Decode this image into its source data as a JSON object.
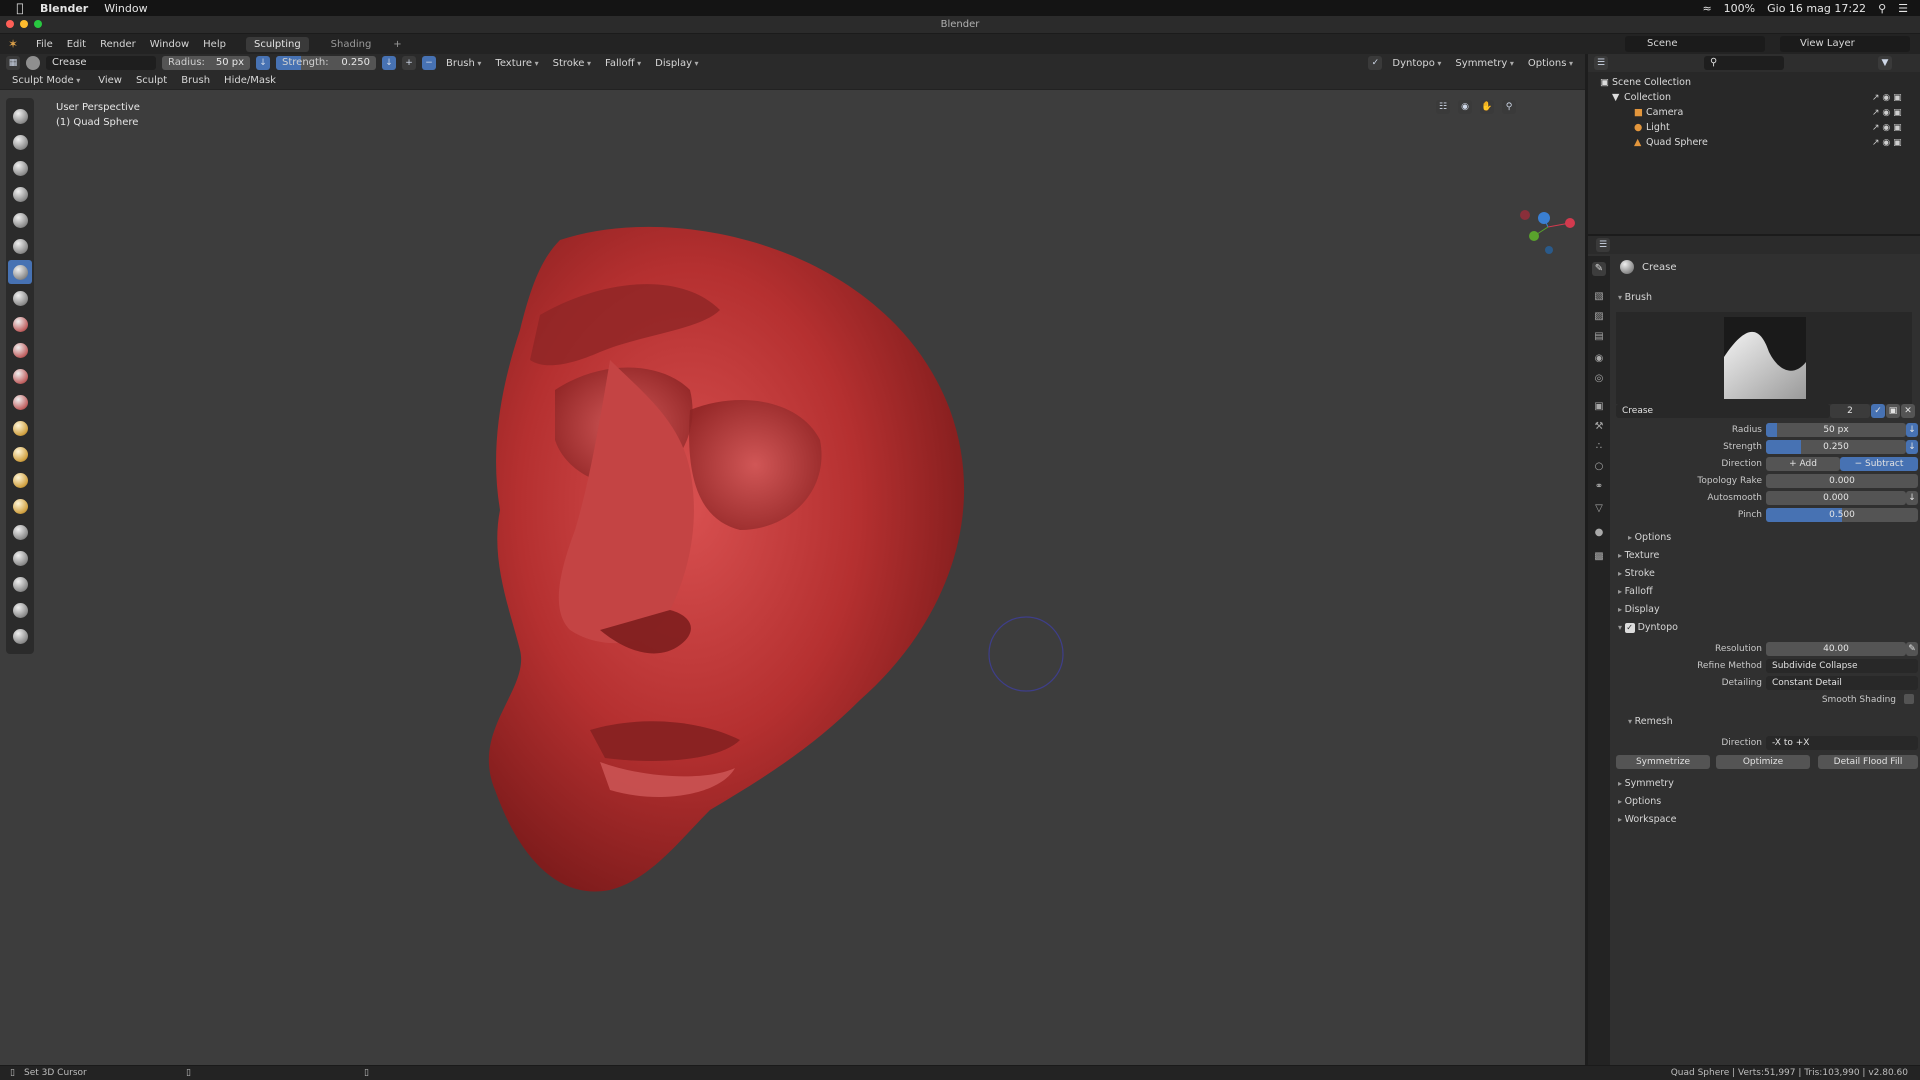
{
  "macbar": {
    "app_name": "Blender",
    "menu_window": "Window",
    "battery": "100%",
    "datetime": "Gio 16 mag  17:22"
  },
  "window": {
    "title": "Blender"
  },
  "menu": {
    "items": [
      "File",
      "Edit",
      "Render",
      "Window",
      "Help"
    ],
    "workspaces": [
      "Sculpting",
      "Shading"
    ],
    "add_tab": "+",
    "scene": "Scene",
    "view_layer": "View Layer"
  },
  "toolheader": {
    "brush_name": "Crease",
    "radius_label": "Radius:",
    "radius_value": "50 px",
    "strength_label": "Strength:",
    "strength_value": "0.250",
    "strength_fraction": 0.25,
    "menus": [
      "Brush",
      "Texture",
      "Stroke",
      "Falloff",
      "Display"
    ],
    "dyntopo": "Dyntopo",
    "symmetry": "Symmetry",
    "options": "Options"
  },
  "moderow": {
    "mode": "Sculpt Mode",
    "items": [
      "View",
      "Sculpt",
      "Brush",
      "Hide/Mask"
    ]
  },
  "viewport": {
    "perspective": "User Perspective",
    "object": "(1) Quad Sphere",
    "tool_count": 21,
    "active_tool_index": 6
  },
  "outliner": {
    "root": "Scene Collection",
    "collection": "Collection",
    "objects": [
      "Camera",
      "Light",
      "Quad Sphere"
    ]
  },
  "props": {
    "tool_name": "Crease",
    "brush_section": "Brush",
    "brush_datablock": "Crease",
    "brush_users": "2",
    "fields": {
      "radius": {
        "label": "Radius",
        "value": "50 px",
        "fraction": 0.08
      },
      "strength": {
        "label": "Strength",
        "value": "0.250",
        "fraction": 0.25
      },
      "direction": {
        "label": "Direction",
        "add": "Add",
        "subtract": "Subtract"
      },
      "topology_rake": {
        "label": "Topology Rake",
        "value": "0.000"
      },
      "autosmooth": {
        "label": "Autosmooth",
        "value": "0.000"
      },
      "pinch": {
        "label": "Pinch",
        "value": "0.500",
        "fraction": 0.5
      }
    },
    "sections": [
      "Options",
      "Texture",
      "Stroke",
      "Falloff",
      "Display"
    ],
    "dyntopo": {
      "title": "Dyntopo",
      "resolution_label": "Resolution",
      "resolution_value": "40.00",
      "refine_label": "Refine Method",
      "refine_value": "Subdivide Collapse",
      "detailing_label": "Detailing",
      "detailing_value": "Constant Detail",
      "smooth_shading": "Smooth Shading",
      "remesh": "Remesh",
      "direction_label": "Direction",
      "direction_value": "-X to +X",
      "buttons": [
        "Symmetrize",
        "Optimize",
        "Detail Flood Fill"
      ]
    },
    "bottom_sections": [
      "Symmetry",
      "Options",
      "Workspace"
    ]
  },
  "statusbar": {
    "left": "Set 3D Cursor",
    "right": "Quad Sphere | Verts:51,997 | Tris:103,990 | v2.80.60"
  },
  "colors": {
    "accent": "#4772b3",
    "viewport_bg": "#3d3d3d",
    "head": "#b83232"
  }
}
